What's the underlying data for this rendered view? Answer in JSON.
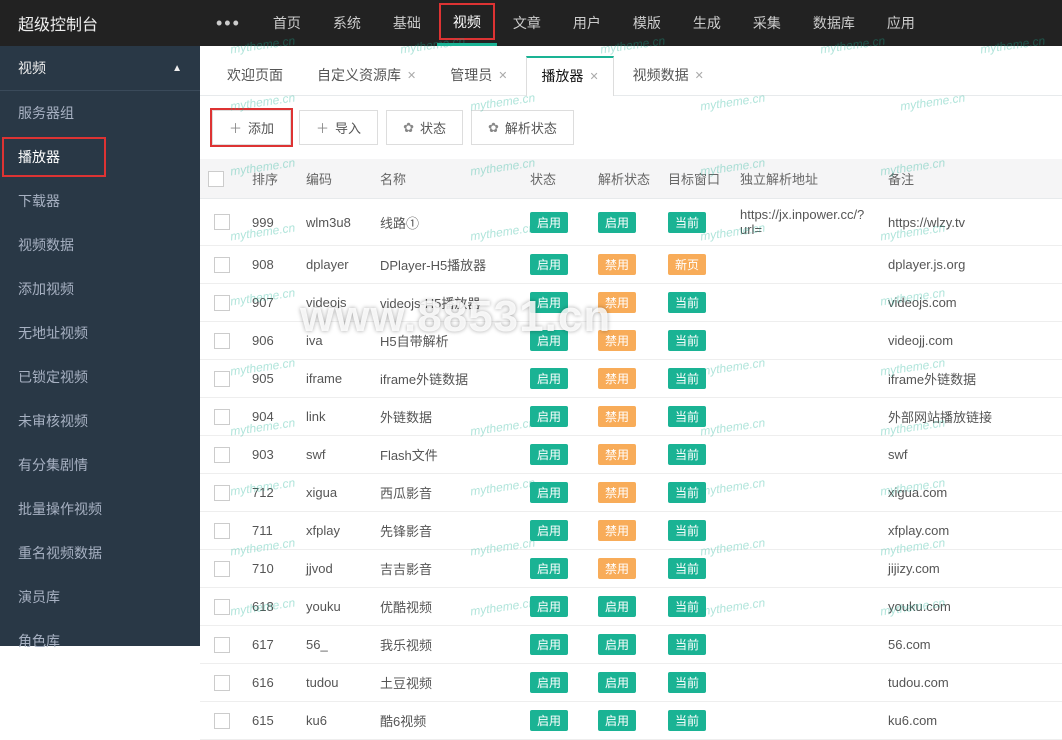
{
  "brand": "超级控制台",
  "topnav": [
    {
      "label": "•••",
      "more": true
    },
    {
      "label": "首页"
    },
    {
      "label": "系统"
    },
    {
      "label": "基础"
    },
    {
      "label": "视频",
      "active": true,
      "highlight": true
    },
    {
      "label": "文章"
    },
    {
      "label": "用户"
    },
    {
      "label": "模版"
    },
    {
      "label": "生成"
    },
    {
      "label": "采集"
    },
    {
      "label": "数据库"
    },
    {
      "label": "应用"
    }
  ],
  "sidebar": {
    "head": "视频",
    "items": [
      {
        "label": "服务器组"
      },
      {
        "label": "播放器",
        "active": true,
        "highlight": true
      },
      {
        "label": "下载器"
      },
      {
        "label": "视频数据"
      },
      {
        "label": "添加视频"
      },
      {
        "label": "无地址视频"
      },
      {
        "label": "已锁定视频"
      },
      {
        "label": "未审核视频"
      },
      {
        "label": "有分集剧情"
      },
      {
        "label": "批量操作视频"
      },
      {
        "label": "重名视频数据"
      },
      {
        "label": "演员库"
      },
      {
        "label": "角色库"
      }
    ]
  },
  "tabs": [
    {
      "label": "欢迎页面",
      "closable": false
    },
    {
      "label": "自定义资源库",
      "closable": true
    },
    {
      "label": "管理员",
      "closable": true
    },
    {
      "label": "播放器",
      "closable": true,
      "active": true
    },
    {
      "label": "视频数据",
      "closable": true
    }
  ],
  "toolbar": [
    {
      "icon": "＋",
      "label": "添加",
      "highlight": true
    },
    {
      "icon": "＋",
      "label": "导入"
    },
    {
      "icon": "✿",
      "label": "状态"
    },
    {
      "icon": "✿",
      "label": "解析状态"
    }
  ],
  "table": {
    "headers": [
      "",
      "排序",
      "编码",
      "名称",
      "状态",
      "解析状态",
      "目标窗口",
      "独立解析地址",
      "备注"
    ],
    "rows": [
      {
        "sort": "999",
        "code": "wlm3u8",
        "name": "线路①",
        "state": "启用",
        "parse": "启用",
        "parse_c": "green",
        "target": "当前",
        "target_c": "green",
        "url": "https://jx.inpower.cc/?url=",
        "note": "https://wlzy.tv"
      },
      {
        "sort": "908",
        "code": "dplayer",
        "name": "DPlayer-H5播放器",
        "state": "启用",
        "parse": "禁用",
        "parse_c": "orange",
        "target": "新页",
        "target_c": "orange",
        "url": "",
        "note": "dplayer.js.org"
      },
      {
        "sort": "907",
        "code": "videojs",
        "name": "videojs-H5播放器",
        "state": "启用",
        "parse": "禁用",
        "parse_c": "orange",
        "target": "当前",
        "target_c": "green",
        "url": "",
        "note": "videojs.com"
      },
      {
        "sort": "906",
        "code": "iva",
        "name": "H5自带解析",
        "state": "启用",
        "parse": "禁用",
        "parse_c": "orange",
        "target": "当前",
        "target_c": "green",
        "url": "",
        "note": "videojj.com"
      },
      {
        "sort": "905",
        "code": "iframe",
        "name": "iframe外链数据",
        "state": "启用",
        "parse": "禁用",
        "parse_c": "orange",
        "target": "当前",
        "target_c": "green",
        "url": "",
        "note": "iframe外链数据"
      },
      {
        "sort": "904",
        "code": "link",
        "name": "外链数据",
        "state": "启用",
        "parse": "禁用",
        "parse_c": "orange",
        "target": "当前",
        "target_c": "green",
        "url": "",
        "note": "外部网站播放链接"
      },
      {
        "sort": "903",
        "code": "swf",
        "name": "Flash文件",
        "state": "启用",
        "parse": "禁用",
        "parse_c": "orange",
        "target": "当前",
        "target_c": "green",
        "url": "",
        "note": "swf"
      },
      {
        "sort": "712",
        "code": "xigua",
        "name": "西瓜影音",
        "state": "启用",
        "parse": "禁用",
        "parse_c": "orange",
        "target": "当前",
        "target_c": "green",
        "url": "",
        "note": "xigua.com"
      },
      {
        "sort": "711",
        "code": "xfplay",
        "name": "先锋影音",
        "state": "启用",
        "parse": "禁用",
        "parse_c": "orange",
        "target": "当前",
        "target_c": "green",
        "url": "",
        "note": "xfplay.com"
      },
      {
        "sort": "710",
        "code": "jjvod",
        "name": "吉吉影音",
        "state": "启用",
        "parse": "禁用",
        "parse_c": "orange",
        "target": "当前",
        "target_c": "green",
        "url": "",
        "note": "jijizy.com"
      },
      {
        "sort": "618",
        "code": "youku",
        "name": "优酷视频",
        "state": "启用",
        "parse": "启用",
        "parse_c": "green",
        "target": "当前",
        "target_c": "green",
        "url": "",
        "note": "youku.com"
      },
      {
        "sort": "617",
        "code": "56_",
        "name": "我乐视频",
        "state": "启用",
        "parse": "启用",
        "parse_c": "green",
        "target": "当前",
        "target_c": "green",
        "url": "",
        "note": "56.com"
      },
      {
        "sort": "616",
        "code": "tudou",
        "name": "土豆视频",
        "state": "启用",
        "parse": "启用",
        "parse_c": "green",
        "target": "当前",
        "target_c": "green",
        "url": "",
        "note": "tudou.com"
      },
      {
        "sort": "615",
        "code": "ku6",
        "name": "酷6视频",
        "state": "启用",
        "parse": "启用",
        "parse_c": "green",
        "target": "当前",
        "target_c": "green",
        "url": "",
        "note": "ku6.com"
      }
    ]
  },
  "watermark_main": "www.88531.cn",
  "watermark_small": "mytheme.cn"
}
